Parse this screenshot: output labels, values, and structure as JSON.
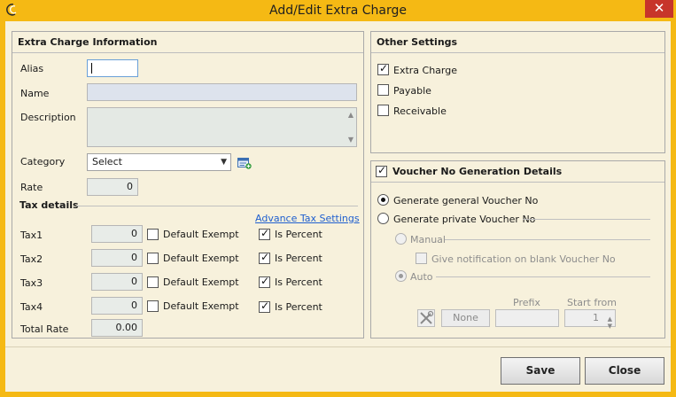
{
  "window": {
    "title": "Add/Edit Extra Charge",
    "close_label": "✕"
  },
  "info": {
    "title": "Extra Charge Information",
    "alias_label": "Alias",
    "name_label": "Name",
    "description_label": "Description",
    "category_label": "Category",
    "category_value": "Select",
    "rate_label": "Rate",
    "rate_value": "0",
    "tax_details_label": "Tax details",
    "advance_tax_link": "Advance Tax Settings",
    "default_exempt_label": "Default Exempt",
    "is_percent_label": "Is Percent",
    "taxes": [
      {
        "label": "Tax1",
        "value": "0",
        "default_exempt": false,
        "is_percent": true
      },
      {
        "label": "Tax2",
        "value": "0",
        "default_exempt": false,
        "is_percent": true
      },
      {
        "label": "Tax3",
        "value": "0",
        "default_exempt": false,
        "is_percent": true
      },
      {
        "label": "Tax4",
        "value": "0",
        "default_exempt": false,
        "is_percent": true
      }
    ],
    "total_rate_label": "Total Rate",
    "total_rate_value": "0.00"
  },
  "other": {
    "title": "Other Settings",
    "extra_charge_label": "Extra Charge",
    "payable_label": "Payable",
    "receivable_label": "Receivable"
  },
  "voucher": {
    "title": "Voucher No Generation Details",
    "general_label": "Generate general Voucher No",
    "private_label": "Generate private Voucher No",
    "manual_label": "Manual",
    "notify_label": "Give notification on blank Voucher No",
    "auto_label": "Auto",
    "prefix_label": "Prefix",
    "start_from_label": "Start from",
    "none_label": "None",
    "start_from_value": "1"
  },
  "buttons": {
    "save": "Save",
    "close": "Close"
  },
  "colors": {
    "titlebar": "#f5b914",
    "panel": "#f7f1dc",
    "link": "#1f5fcf",
    "close": "#c7352a"
  }
}
